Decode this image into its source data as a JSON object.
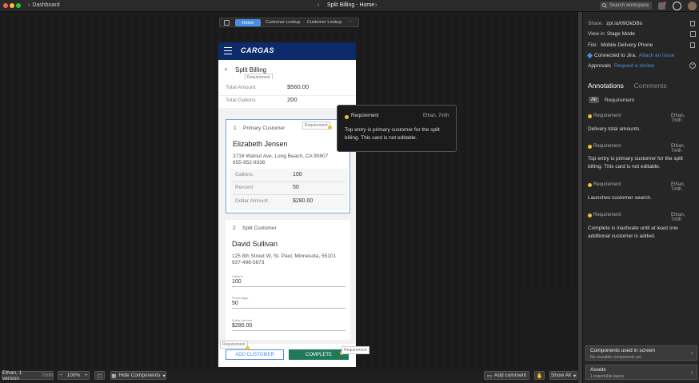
{
  "window": {
    "back_label": "Dashboard",
    "title": "Split Billing - Home",
    "search_placeholder": "Search workspace"
  },
  "toolbar": {
    "tabs": [
      "Home",
      "Customer Lookup",
      "Customer Lookup"
    ],
    "more": "···"
  },
  "phone": {
    "brand": "CARGAS",
    "page_title": "Split Billing",
    "requirement_tag": "Requirement",
    "summary": [
      {
        "label": "Total Amount",
        "value": "$560.00"
      },
      {
        "label": "Total Gallons",
        "value": "200"
      }
    ],
    "primary": {
      "number": "1",
      "heading": "Primary Customer",
      "name": "Elizabeth Jensen",
      "address": "3716 Walnut Ave, Long Beach, CA 90807",
      "phone": "655-952-9336",
      "rows": [
        {
          "label": "Gallons",
          "value": "100"
        },
        {
          "label": "Percent",
          "value": "50"
        },
        {
          "label": "Dollar Amount",
          "value": "$280.00"
        }
      ]
    },
    "split": {
      "number": "2",
      "heading": "Split Customer",
      "name": "David Sullivan",
      "address": "125 8th Street W, St. Paul, Minnesota, 55101",
      "phone": "937-496-5673",
      "fields": [
        {
          "label": "Gallons",
          "value": "100"
        },
        {
          "label": "Percentage",
          "value": "50"
        },
        {
          "label": "Dollar Amount",
          "value": "$280.00"
        }
      ]
    },
    "buttons": {
      "add": "ADD CUSTOMER",
      "complete": "COMPLETE"
    }
  },
  "tooltip": {
    "tag": "Requirement",
    "author": "Ethan, 7mth",
    "text": "Top entry is primary customer for the split billing. This card is not editable."
  },
  "panel": {
    "share_label": "Share:",
    "share_link": "zpl.io/09GkDBo",
    "view_prefix": "View in",
    "view_mode": "Stage Mode",
    "file_label": "File:",
    "file_name": "Mobile Delivery Phone",
    "jira_text": "Connected to Jira.",
    "jira_link": "Attach an issue",
    "approvals_label": "Approvals",
    "approvals_link": "Request a review",
    "tab_annotations": "Annotations",
    "tab_separator": "·",
    "tab_comments": "Comments",
    "filter_all": "All",
    "filter_req": "Requirement",
    "annotations": [
      {
        "tag": "Requirement",
        "author": "Ethan, 7mth",
        "text": "Delivery total amounts."
      },
      {
        "tag": "Requirement",
        "author": "Ethan, 7mth",
        "text": "Top entry is primary customer for the split billing. This card is not editable."
      },
      {
        "tag": "Requirement",
        "author": "Ethan, 7mth",
        "text": "Launches customer search."
      },
      {
        "tag": "Requirement",
        "author": "Ethan, 7mth",
        "text": "Complete is inactivate until at least one additional customer is added."
      }
    ],
    "components_title": "Components used in screen",
    "components_sub": "No reusable components yet",
    "assets_title": "Assets",
    "assets_sub": "1 exportable layers"
  },
  "bottom": {
    "version": "Ethan, 1 version",
    "version_age": "7mth",
    "zoom": "100%",
    "hide_components": "Hide Components",
    "add_comment": "Add comment",
    "show_all": "Show All"
  },
  "colors": {
    "accent": "#4a90e2",
    "brand_bar": "#0d2a6b",
    "complete_green": "#1f7a5c",
    "annotation_dot": "#f2c037"
  }
}
